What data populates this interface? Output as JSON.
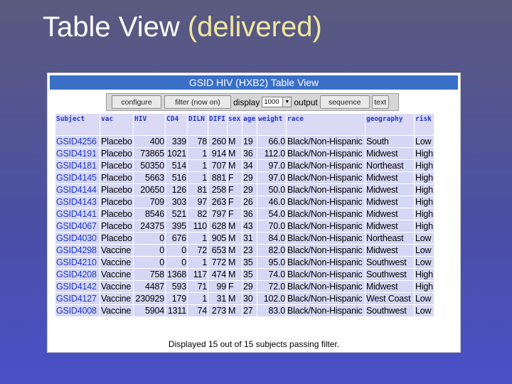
{
  "slide": {
    "title": "Table View",
    "title_paren": "(delivered)"
  },
  "app": {
    "header": "GSID HIV (HXB2) Table View",
    "toolbar": {
      "configure": "configure",
      "filter": "filter (now on)",
      "display_label": "display",
      "display_value": "1000",
      "output_label": "output",
      "sequence": "sequence",
      "text": "text"
    },
    "columns": [
      "Subject",
      "vac",
      "HIV",
      "CD4",
      "DILN",
      "DIFI",
      "sex",
      "age",
      "weight",
      "race",
      "geography",
      "risk"
    ],
    "rows": [
      [
        "GSID4256",
        "Placebo",
        "400",
        "339",
        "78",
        "260",
        "M",
        "19",
        "66.0",
        "Black/Non-Hispanic",
        "South",
        "Low"
      ],
      [
        "GSID4191",
        "Placebo",
        "73865",
        "1021",
        "1",
        "914",
        "M",
        "36",
        "112.0",
        "Black/Non-Hispanic",
        "Midwest",
        "High"
      ],
      [
        "GSID4181",
        "Placebo",
        "50350",
        "514",
        "1",
        "707",
        "M",
        "34",
        "97.0",
        "Black/Non-Hispanic",
        "Northeast",
        "High"
      ],
      [
        "GSID4145",
        "Placebo",
        "5663",
        "516",
        "1",
        "881",
        "F",
        "29",
        "97.0",
        "Black/Non-Hispanic",
        "Midwest",
        "High"
      ],
      [
        "GSID4144",
        "Placebo",
        "20650",
        "126",
        "81",
        "258",
        "F",
        "29",
        "50.0",
        "Black/Non-Hispanic",
        "Midwest",
        "High"
      ],
      [
        "GSID4143",
        "Placebo",
        "709",
        "303",
        "97",
        "263",
        "F",
        "26",
        "46.0",
        "Black/Non-Hispanic",
        "Midwest",
        "High"
      ],
      [
        "GSID4141",
        "Placebo",
        "8546",
        "521",
        "82",
        "797",
        "F",
        "36",
        "54.0",
        "Black/Non-Hispanic",
        "Midwest",
        "High"
      ],
      [
        "GSID4067",
        "Placebo",
        "24375",
        "395",
        "110",
        "628",
        "M",
        "43",
        "70.0",
        "Black/Non-Hispanic",
        "Midwest",
        "High"
      ],
      [
        "GSID4030",
        "Placebo",
        "0",
        "676",
        "1",
        "905",
        "M",
        "31",
        "84.0",
        "Black/Non-Hispanic",
        "Northeast",
        "Low"
      ],
      [
        "GSID4298",
        "Vaccine",
        "0",
        "0",
        "72",
        "653",
        "M",
        "23",
        "82.0",
        "Black/Non-Hispanic",
        "Midwest",
        "Low"
      ],
      [
        "GSID4210",
        "Vaccine",
        "0",
        "0",
        "1",
        "772",
        "M",
        "35",
        "95.0",
        "Black/Non-Hispanic",
        "Southwest",
        "Low"
      ],
      [
        "GSID4208",
        "Vaccine",
        "758",
        "1368",
        "117",
        "474",
        "M",
        "35",
        "74.0",
        "Black/Non-Hispanic",
        "Southwest",
        "High"
      ],
      [
        "GSID4142",
        "Vaccine",
        "4487",
        "593",
        "71",
        "99",
        "F",
        "29",
        "72.0",
        "Black/Non-Hispanic",
        "Midwest",
        "High"
      ],
      [
        "GSID4127",
        "Vaccine",
        "230929",
        "179",
        "1",
        "31",
        "M",
        "30",
        "102.0",
        "Black/Non-Hispanic",
        "West Coast",
        "Low"
      ],
      [
        "GSID4008",
        "Vaccine",
        "5904",
        "1311",
        "74",
        "273",
        "M",
        "27",
        "83.0",
        "Black/Non-Hispanic",
        "Southwest",
        "Low"
      ]
    ],
    "footer": "Displayed 15 out of 15 subjects passing filter."
  }
}
